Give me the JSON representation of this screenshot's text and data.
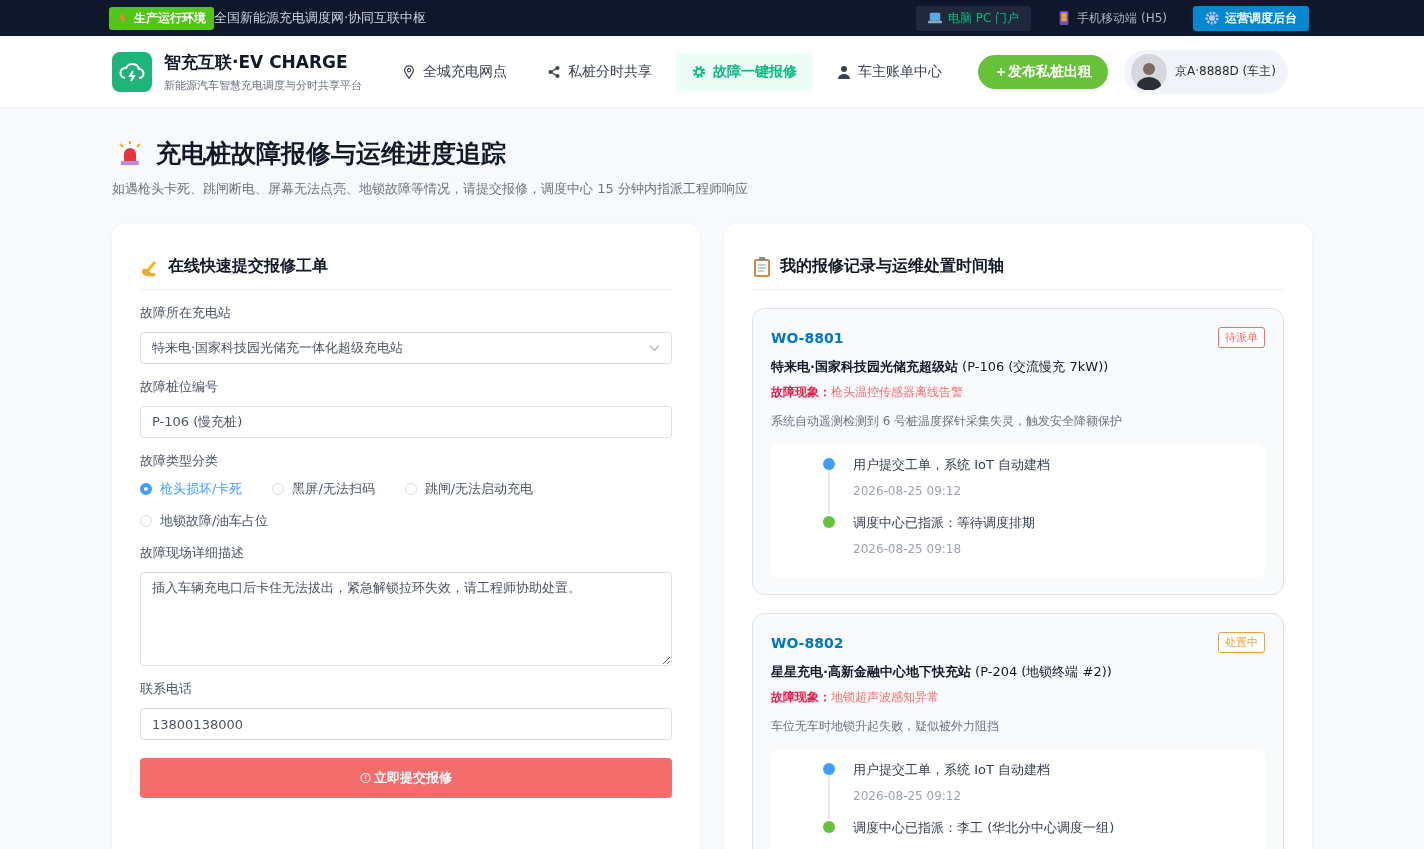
{
  "topbar": {
    "env_badge": "生产运行环境",
    "tagline": "全国新能源充电调度网·协同互联中枢",
    "portals": [
      {
        "kind": "pc",
        "label": "电脑 PC 门户",
        "selected": true
      },
      {
        "kind": "mobile",
        "label": "手机移动端 (H5)",
        "selected": false
      }
    ],
    "admin_button": "运营调度后台"
  },
  "header": {
    "brand": "智充互联·EV CHARGE",
    "slogan": "新能源汽车智慧充电调度与分时共享平台",
    "nav": [
      {
        "kind": "pin",
        "label": "全城充电网点",
        "selected": false
      },
      {
        "kind": "share",
        "label": "私桩分时共享",
        "selected": false
      },
      {
        "kind": "gear",
        "label": "故障一键报修",
        "selected": true
      },
      {
        "kind": "user",
        "label": "车主账单中心",
        "selected": false
      }
    ],
    "publish_button": "＋发布私桩出租",
    "user": "京A·8888D (车主)"
  },
  "page": {
    "title": "充电桩故障报修与运维进度追踪",
    "subtitle": "如遇枪头卡死、跳闸断电、屏幕无法点亮、地锁故障等情况，请提交报修，调度中心 15 分钟内指派工程师响应"
  },
  "form": {
    "title": "在线快速提交报修工单",
    "station": {
      "label": "故障所在充电站",
      "value": "特来电·国家科技园光储充一体化超级充电站"
    },
    "pile": {
      "label": "故障桩位编号",
      "value": "P-106 (慢充桩)"
    },
    "fault_type": {
      "label": "故障类型分类",
      "options": [
        {
          "label": "枪头损坏/卡死",
          "selected": true
        },
        {
          "label": "黑屏/无法扫码",
          "selected": false
        },
        {
          "label": "跳闸/无法启动充电",
          "selected": false
        },
        {
          "label": "地锁故障/油车占位",
          "selected": false
        }
      ]
    },
    "description": {
      "label": "故障现场详细描述",
      "value": "插入车辆充电口后卡住无法拔出，紧急解锁拉环失效，请工程师协助处置。"
    },
    "phone": {
      "label": "联系电话",
      "value": "13800138000"
    },
    "submit": "立即提交报修"
  },
  "records": {
    "title": "我的报修记录与运维处置时间轴",
    "orders": [
      {
        "id": "WO-8801",
        "status": "待派单",
        "color": "#f56c6c",
        "station": "特来电·国家科技园光储充超级站",
        "pile": "(P-106 (交流慢充 7kW))",
        "symptom_label": "故障现象：",
        "symptom": "枪头温控传感器离线告警",
        "note": "系统自动遥测检测到 6 号桩温度探针采集失灵，触发安全降额保护",
        "timeline": [
          {
            "text": "用户提交工单，系统 IoT 自动建档",
            "time": "2026-08-25 09:12",
            "color": "#409eff"
          },
          {
            "text": "调度中心已指派：等待调度排期",
            "time": "2026-08-25 09:18",
            "color": "#67c23a"
          }
        ]
      },
      {
        "id": "WO-8802",
        "status": "处置中",
        "color": "#e6a23c",
        "station": "星星充电·高新金融中心地下快充站",
        "pile": "(P-204 (地锁终端 #2))",
        "symptom_label": "故障现象：",
        "symptom": "地锁超声波感知异常",
        "note": "车位无车时地锁升起失败，疑似被外力阻挡",
        "timeline": [
          {
            "text": "用户提交工单，系统 IoT 自动建档",
            "time": "2026-08-25 09:12",
            "color": "#409eff"
          },
          {
            "text": "调度中心已指派：李工 (华北分中心调度一组)",
            "color": "#67c23a"
          }
        ]
      }
    ]
  }
}
